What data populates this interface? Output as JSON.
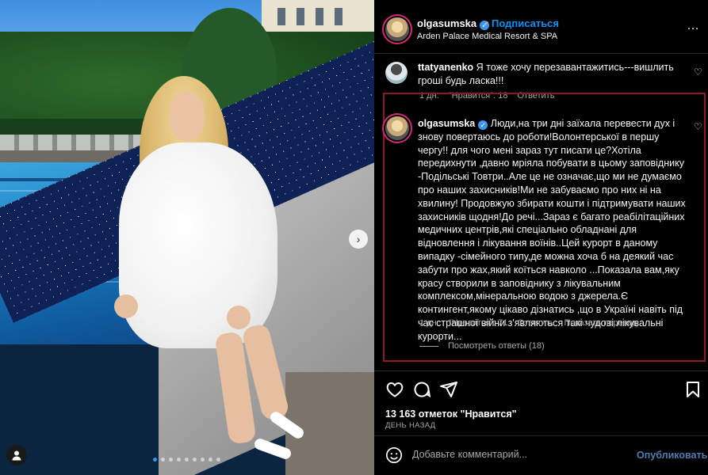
{
  "post": {
    "author": "olgasumska",
    "follow_label": "Подписаться",
    "separator": "•",
    "location": "Arden Palace Medical Resort & SPA",
    "more_icon": "…",
    "carousel_dots_count": 9,
    "carousel_active_index": 0
  },
  "comments": [
    {
      "author": "ttatyanenko",
      "text": "Я тоже хочу перезавантажитись---вишлить гроші будь ласка!!!",
      "time": "1 дн.",
      "likes": "\"Нравится\": 18",
      "reply": "Ответить"
    },
    {
      "author": "olgasumska",
      "text": "Люди,на три дні заїхала перевести дух і знову повертаюсь до роботи!Волонтерської в першу чергу!! для чого мені зараз тут писати це?Хотіла передихнути ,давно мріяла побувати в цьому заповіднику -Подільські Товтри..Але це не означає,що ми не думаємо про наших захисників!Ми не забуваємо про них ні на хвилину! Продовжую збирати кошти і підтримувати наших захисників щодня!До речі...Зараз є багато реабілітаційних медичних центрів,які спеціально обладнані для відновлення і лікування воїнів..Цей курорт в даному випадку -сімейного типу,де можна хоча б на деякий час забути про жах,який коїться навколо ...Показала вам,яку красу створили в заповіднику з лікувальним комплексом,мінеральною водою з джерела.Є контингент,якому цікаво дізнатись ,що в Україні навіть під час страшної війни з'являються такі чудові лікувальні курорти...",
      "time": "1 дн.",
      "likes": "\"Нравится\": 71",
      "reply": "Ответить",
      "translate": "Показать перевод",
      "view_replies": "Посмотреть ответы (18)"
    }
  ],
  "footer": {
    "likes_count": "13 163",
    "likes_label": "отметок \"Нравится\"",
    "time": "ДЕНЬ НАЗАД",
    "add_comment_placeholder": "Добавьте комментарий...",
    "publish_label": "Опубликовать"
  },
  "colors": {
    "verified": "#3897f0",
    "follow": "#0095f6",
    "highlight_border": "#8b1a24",
    "publish": "#4f7db3"
  }
}
